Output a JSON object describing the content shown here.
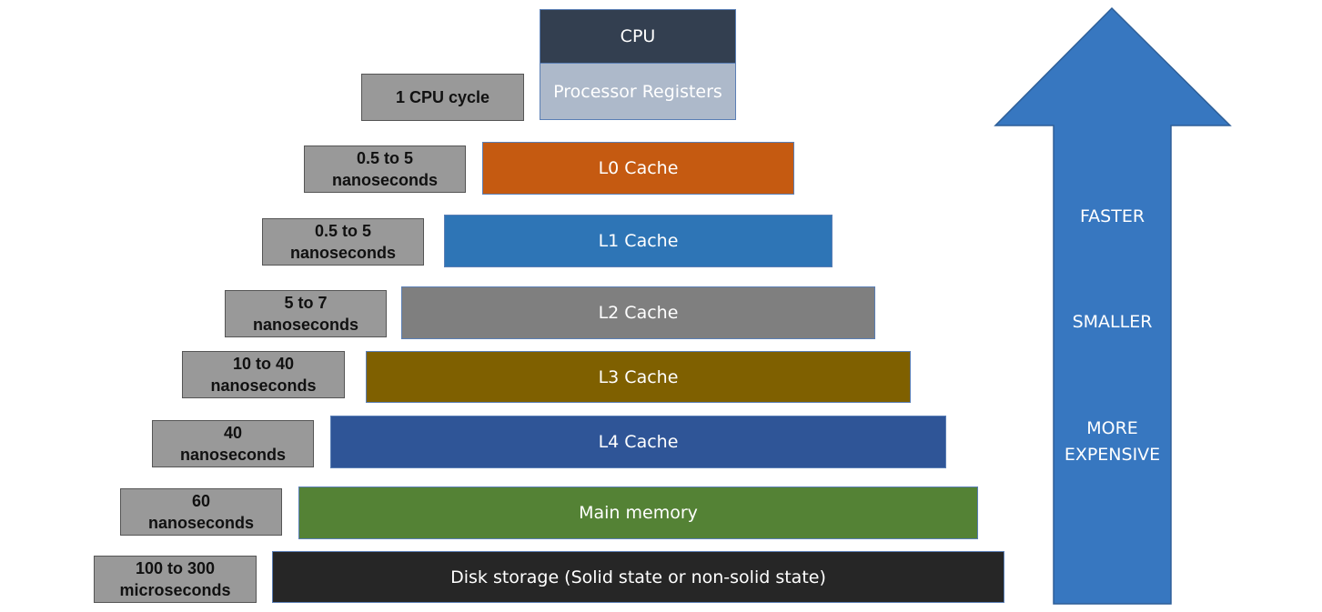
{
  "tiers": {
    "cpu": {
      "label": "CPU",
      "color": "#333f50"
    },
    "registers": {
      "label": "Processor Registers",
      "color": "#adb9ca",
      "latency": [
        "1 CPU cycle"
      ]
    },
    "l0": {
      "label": "L0 Cache",
      "color": "#c55a11",
      "latency": [
        "0.5 to 5",
        "nanoseconds"
      ]
    },
    "l1": {
      "label": "L1 Cache",
      "color": "#2e75b6",
      "latency": [
        "0.5 to 5",
        "nanoseconds"
      ]
    },
    "l2": {
      "label": "L2 Cache",
      "color": "#7f7f7f",
      "latency": [
        "5 to 7",
        "nanoseconds"
      ]
    },
    "l3": {
      "label": "L3 Cache",
      "color": "#7f6000",
      "latency": [
        "10 to 40",
        "nanoseconds"
      ]
    },
    "l4": {
      "label": "L4 Cache",
      "color": "#2f5597",
      "latency": [
        "40",
        "nanoseconds"
      ]
    },
    "main": {
      "label": "Main memory",
      "color": "#548235",
      "latency": [
        "60",
        "nanoseconds"
      ]
    },
    "disk": {
      "label": "Disk storage (Solid state or non-solid state)",
      "color": "#262626",
      "latency": [
        "100 to 300",
        "microseconds"
      ]
    }
  },
  "arrow": {
    "color": "#3777c0",
    "labels": [
      "FASTER",
      "SMALLER",
      "MORE",
      "EXPENSIVE"
    ]
  }
}
